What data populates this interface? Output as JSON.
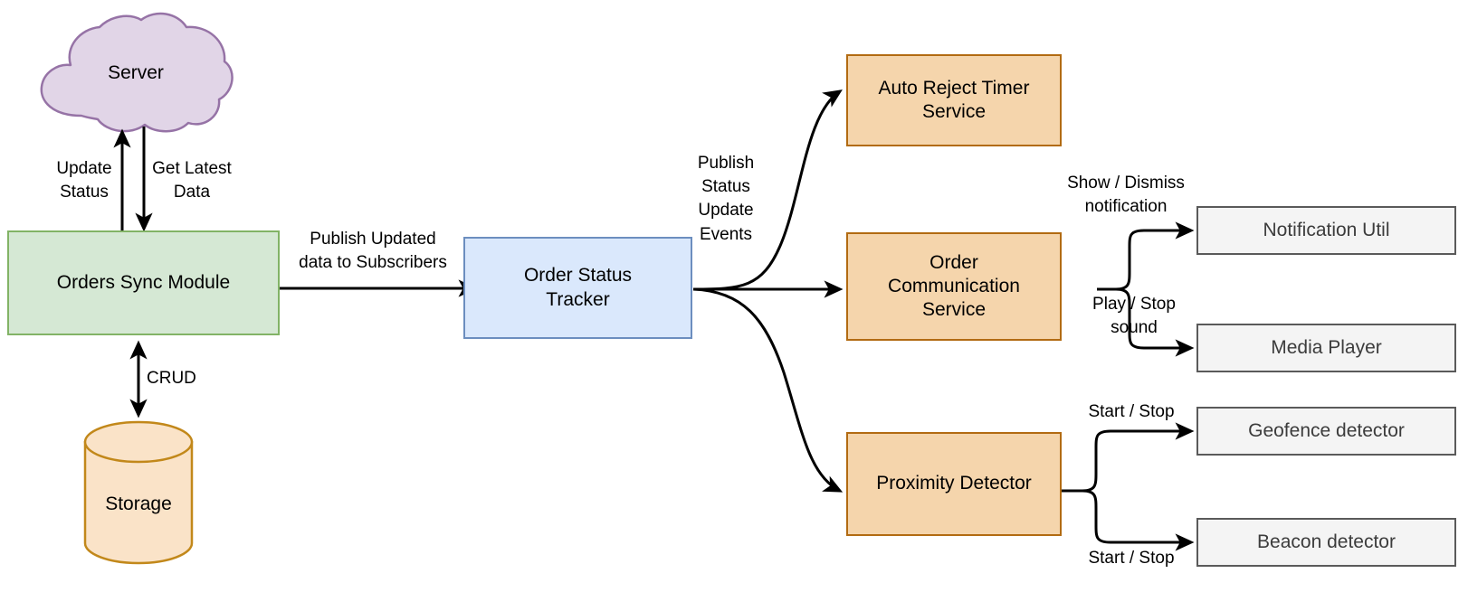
{
  "diagram": {
    "title": "Orders Sync and Order Status Tracker Architecture",
    "background": "#ffffff",
    "palette": {
      "green_fill": "#d5e8d4",
      "green_stroke": "#82b366",
      "blue_fill": "#dae8fc",
      "blue_stroke": "#6c8ebf",
      "orange_fill": "#f5d5ac",
      "orange_stroke": "#b26b12",
      "gray_fill": "#f4f4f4",
      "gray_stroke": "#5a5a5a",
      "purple_fill": "#e1d5e7",
      "purple_stroke": "#9673a6",
      "edge_stroke": "#000000"
    },
    "nodes": {
      "server": {
        "label": "Server",
        "shape": "cloud"
      },
      "orders_sync_module": {
        "label": "Orders Sync Module",
        "shape": "rectangle"
      },
      "storage": {
        "label": "Storage",
        "shape": "cylinder"
      },
      "order_status_tracker": {
        "label": "Order Status\nTracker",
        "shape": "rectangle"
      },
      "auto_reject_timer_service": {
        "label": "Auto Reject Timer\nService",
        "shape": "rectangle"
      },
      "order_communication_service": {
        "label": "Order\nCommunication\nService",
        "shape": "rectangle"
      },
      "proximity_detector": {
        "label": "Proximity Detector",
        "shape": "rectangle"
      },
      "notification_util": {
        "label": "Notification Util",
        "shape": "rectangle"
      },
      "media_player": {
        "label": "Media Player",
        "shape": "rectangle"
      },
      "geofence_detector": {
        "label": "Geofence detector",
        "shape": "rectangle"
      },
      "beacon_detector": {
        "label": "Beacon detector",
        "shape": "rectangle"
      }
    },
    "edge_labels": {
      "update_status": "Update\nStatus",
      "get_latest_data": "Get Latest\nData",
      "crud": "CRUD",
      "publish_updated_data": "Publish Updated\ndata to Subscribers",
      "publish_status_update_events": "Publish\nStatus\nUpdate\nEvents",
      "show_dismiss_notification": "Show / Dismiss\nnotification",
      "play_stop_sound": "Play / Stop\nsound",
      "start_stop_geofence": "Start / Stop",
      "start_stop_beacon": "Start / Stop"
    },
    "edges": [
      {
        "from": "orders_sync_module",
        "to": "server",
        "label": "Update\nStatus"
      },
      {
        "from": "server",
        "to": "orders_sync_module",
        "label": "Get Latest\nData"
      },
      {
        "from": "orders_sync_module",
        "to": "storage",
        "label": "CRUD",
        "bidirectional": true
      },
      {
        "from": "orders_sync_module",
        "to": "order_status_tracker",
        "label": "Publish Updated\ndata to Subscribers"
      },
      {
        "from": "order_status_tracker",
        "to": "auto_reject_timer_service",
        "label": "Publish\nStatus\nUpdate\nEvents"
      },
      {
        "from": "order_status_tracker",
        "to": "order_communication_service",
        "label": ""
      },
      {
        "from": "order_status_tracker",
        "to": "proximity_detector",
        "label": ""
      },
      {
        "from": "order_communication_service",
        "to": "notification_util",
        "label": "Show / Dismiss\nnotification"
      },
      {
        "from": "order_communication_service",
        "to": "media_player",
        "label": "Play / Stop\nsound"
      },
      {
        "from": "proximity_detector",
        "to": "geofence_detector",
        "label": "Start / Stop"
      },
      {
        "from": "proximity_detector",
        "to": "beacon_detector",
        "label": "Start / Stop"
      }
    ]
  }
}
